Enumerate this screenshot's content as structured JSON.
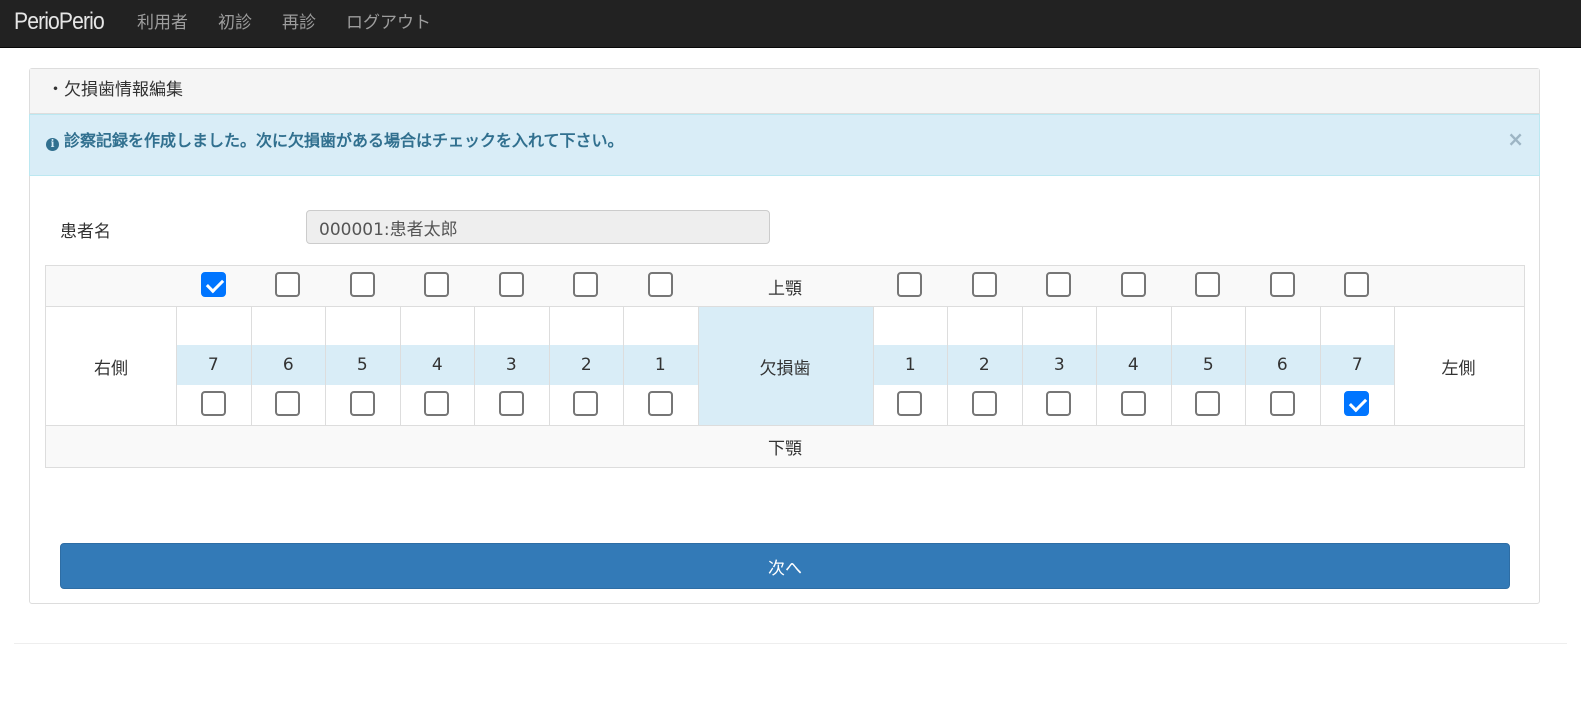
{
  "navbar": {
    "brand": "PerioPerio",
    "items": [
      {
        "label": "利用者"
      },
      {
        "label": "初診"
      },
      {
        "label": "再診"
      },
      {
        "label": "ログアウト"
      }
    ]
  },
  "panel": {
    "heading": "・欠損歯情報編集",
    "alert": {
      "icon": "info-circle-icon",
      "message": "診察記録を作成しました。次に欠損歯がある場合はチェックを入れて下さい。",
      "close": "×"
    },
    "patient": {
      "label": "患者名",
      "value": "000001:患者太郎"
    },
    "teeth": {
      "upper_label": "上顎",
      "lower_label": "下顎",
      "right_label": "右側",
      "left_label": "左側",
      "center_label": "欠損歯",
      "right_numbers": [
        "7",
        "6",
        "5",
        "4",
        "3",
        "2",
        "1"
      ],
      "left_numbers": [
        "1",
        "2",
        "3",
        "4",
        "5",
        "6",
        "7"
      ],
      "upper_right_checked": [
        true,
        false,
        false,
        false,
        false,
        false,
        false
      ],
      "upper_left_checked": [
        false,
        false,
        false,
        false,
        false,
        false,
        false
      ],
      "lower_right_checked": [
        false,
        false,
        false,
        false,
        false,
        false,
        false
      ],
      "lower_left_checked": [
        false,
        false,
        false,
        false,
        false,
        false,
        true
      ]
    },
    "next_button": "次へ"
  },
  "colors": {
    "navbar_bg": "#222222",
    "alert_bg": "#d9edf7",
    "alert_text": "#31708f",
    "primary_button": "#337ab7",
    "checkbox_checked": "#0075ff"
  }
}
